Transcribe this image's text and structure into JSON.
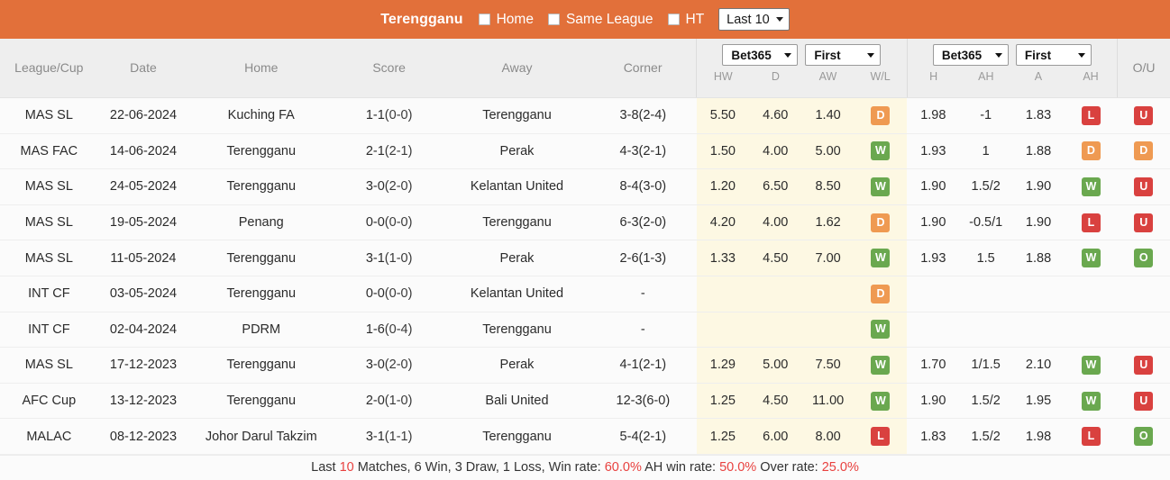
{
  "topbar": {
    "team": "Terengganu",
    "filters": [
      {
        "label": "Home",
        "checked": false
      },
      {
        "label": "Same League",
        "checked": false
      },
      {
        "label": "HT",
        "checked": false
      }
    ],
    "range_select": "Last 10"
  },
  "table": {
    "headers": {
      "league": "League/Cup",
      "date": "Date",
      "home": "Home",
      "score": "Score",
      "away": "Away",
      "corner": "Corner",
      "ou": "O/U"
    },
    "group1": {
      "bookmaker": "Bet365",
      "phase": "First",
      "sub": [
        "HW",
        "D",
        "AW",
        "W/L"
      ]
    },
    "group2": {
      "bookmaker": "Bet365",
      "phase": "First",
      "sub": [
        "H",
        "AH",
        "A",
        "AH"
      ]
    },
    "rows": [
      {
        "league": "MAS SL",
        "date": "22-06-2024",
        "home": "Kuching FA",
        "home_hi": false,
        "score": "1-1",
        "score_ht": "(0-0)",
        "away": "Terengganu",
        "away_hi": true,
        "corner": "3-8(2-4)",
        "hw": "5.50",
        "d": "4.60",
        "aw": "1.40",
        "wl": "D",
        "h": "1.98",
        "ah1": "-1",
        "a": "1.83",
        "ah2": "L",
        "ou": "U"
      },
      {
        "league": "MAS FAC",
        "date": "14-06-2024",
        "home": "Terengganu",
        "home_hi": true,
        "score": "2-1",
        "score_ht": "(2-1)",
        "away": "Perak",
        "away_hi": false,
        "corner": "4-3(2-1)",
        "hw": "1.50",
        "d": "4.00",
        "aw": "5.00",
        "wl": "W",
        "h": "1.93",
        "ah1": "1",
        "a": "1.88",
        "ah2": "D",
        "ou": "D"
      },
      {
        "league": "MAS SL",
        "date": "24-05-2024",
        "home": "Terengganu",
        "home_hi": true,
        "score": "3-0",
        "score_ht": "(2-0)",
        "away": "Kelantan United",
        "away_hi": false,
        "corner": "8-4(3-0)",
        "hw": "1.20",
        "d": "6.50",
        "aw": "8.50",
        "wl": "W",
        "h": "1.90",
        "ah1": "1.5/2",
        "a": "1.90",
        "ah2": "W",
        "ou": "U"
      },
      {
        "league": "MAS SL",
        "date": "19-05-2024",
        "home": "Penang",
        "home_hi": false,
        "score": "0-0",
        "score_ht": "(0-0)",
        "away": "Terengganu",
        "away_hi": true,
        "corner": "6-3(2-0)",
        "hw": "4.20",
        "d": "4.00",
        "aw": "1.62",
        "wl": "D",
        "h": "1.90",
        "ah1": "-0.5/1",
        "a": "1.90",
        "ah2": "L",
        "ou": "U"
      },
      {
        "league": "MAS SL",
        "date": "11-05-2024",
        "home": "Terengganu",
        "home_hi": true,
        "score": "3-1",
        "score_ht": "(1-0)",
        "away": "Perak",
        "away_hi": false,
        "corner": "2-6(1-3)",
        "hw": "1.33",
        "d": "4.50",
        "aw": "7.00",
        "wl": "W",
        "h": "1.93",
        "ah1": "1.5",
        "a": "1.88",
        "ah2": "W",
        "ou": "O"
      },
      {
        "league": "INT CF",
        "date": "03-05-2024",
        "home": "Terengganu",
        "home_hi": true,
        "score": "0-0",
        "score_ht": "(0-0)",
        "away": "Kelantan United",
        "away_hi": false,
        "corner": "-",
        "hw": "",
        "d": "",
        "aw": "",
        "wl": "D",
        "h": "",
        "ah1": "",
        "a": "",
        "ah2": "",
        "ou": ""
      },
      {
        "league": "INT CF",
        "date": "02-04-2024",
        "home": "PDRM",
        "home_hi": false,
        "score": "1-6",
        "score_ht": "(0-4)",
        "away": "Terengganu",
        "away_hi": true,
        "corner": "-",
        "hw": "",
        "d": "",
        "aw": "",
        "wl": "W",
        "h": "",
        "ah1": "",
        "a": "",
        "ah2": "",
        "ou": ""
      },
      {
        "league": "MAS SL",
        "date": "17-12-2023",
        "home": "Terengganu",
        "home_hi": true,
        "score": "3-0",
        "score_ht": "(2-0)",
        "away": "Perak",
        "away_hi": false,
        "corner": "4-1(2-1)",
        "hw": "1.29",
        "d": "5.00",
        "aw": "7.50",
        "wl": "W",
        "h": "1.70",
        "ah1": "1/1.5",
        "a": "2.10",
        "ah2": "W",
        "ou": "U"
      },
      {
        "league": "AFC Cup",
        "date": "13-12-2023",
        "home": "Terengganu",
        "home_hi": true,
        "score": "2-0",
        "score_ht": "(1-0)",
        "away": "Bali United",
        "away_hi": false,
        "corner": "12-3(6-0)",
        "hw": "1.25",
        "d": "4.50",
        "aw": "11.00",
        "wl": "W",
        "h": "1.90",
        "ah1": "1.5/2",
        "a": "1.95",
        "ah2": "W",
        "ou": "U"
      },
      {
        "league": "MALAC",
        "date": "08-12-2023",
        "home": "Johor Darul Takzim",
        "home_hi": false,
        "score": "3-1",
        "score_ht": "(1-1)",
        "away": "Terengganu",
        "away_hi": true,
        "corner": "5-4(2-1)",
        "hw": "1.25",
        "d": "6.00",
        "aw": "8.00",
        "wl": "L",
        "h": "1.83",
        "ah1": "1.5/2",
        "a": "1.98",
        "ah2": "L",
        "ou": "O"
      }
    ]
  },
  "footer": {
    "prefix": "Last ",
    "count": "10",
    "mid": " Matches, 6 Win, 3 Draw, 1 Loss, Win rate: ",
    "win_rate": "60.0%",
    "ah_label": " AH win rate: ",
    "ah_rate": "50.0%",
    "over_label": " Over rate: ",
    "over_rate": "25.0%"
  },
  "colors": {
    "accent": "#e2703a",
    "win": "#6aa84f",
    "draw": "#ef9a52",
    "loss": "#d9413f",
    "score": "#d0392b",
    "highlight_row": "#fdf8e3"
  }
}
